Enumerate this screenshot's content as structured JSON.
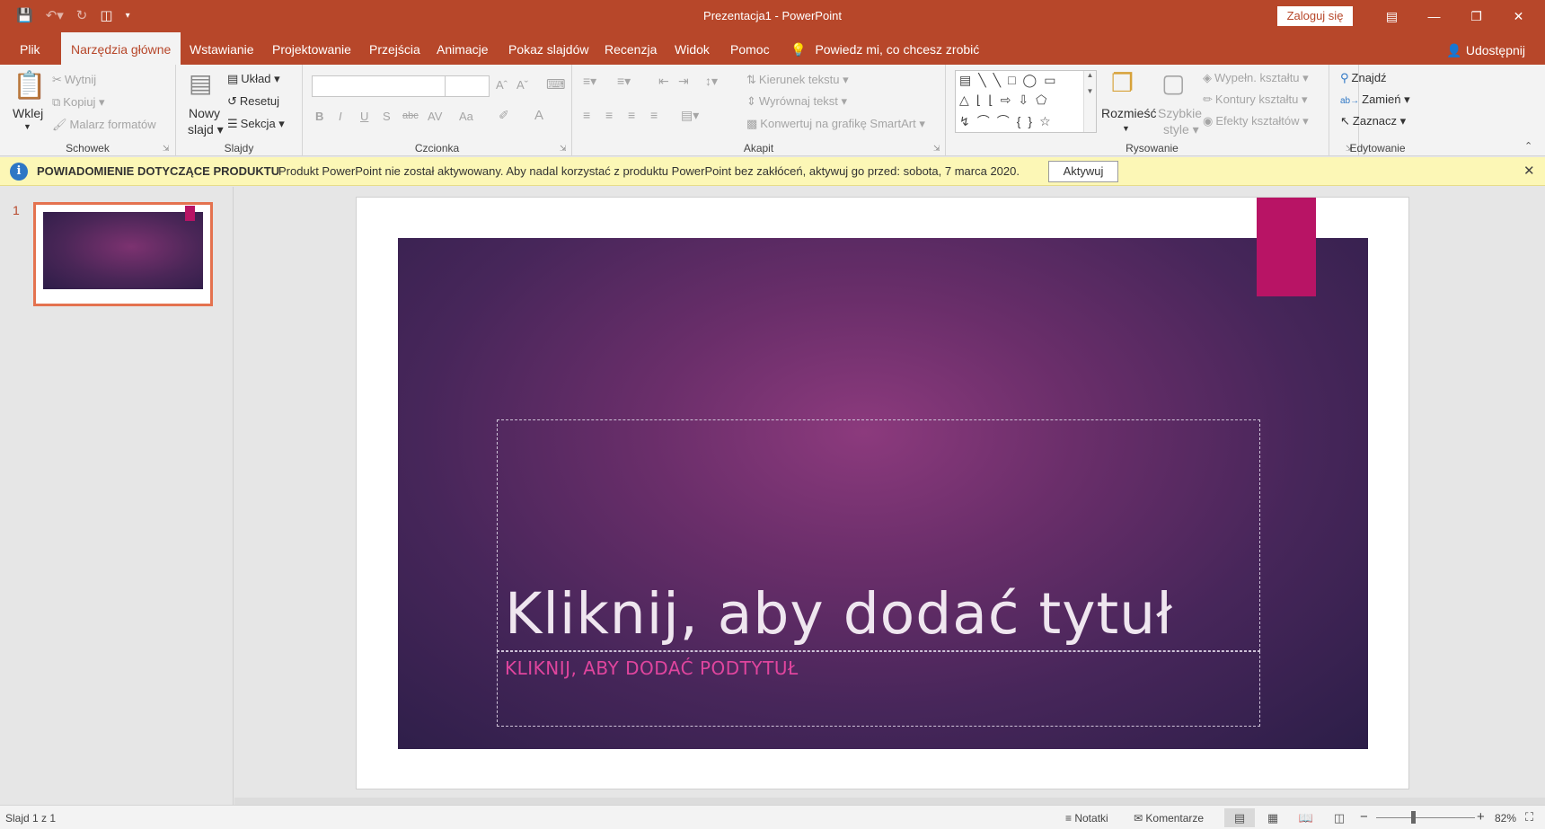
{
  "window": {
    "title": "Prezentacja1  -  PowerPoint",
    "login_label": "Zaloguj się"
  },
  "qat": {
    "icons": [
      "save-icon",
      "undo-icon",
      "redo-icon",
      "start-slideshow-icon",
      "customize-qat-icon"
    ]
  },
  "tabs": [
    {
      "label": "Plik"
    },
    {
      "label": "Narzędzia główne",
      "active": true
    },
    {
      "label": "Wstawianie"
    },
    {
      "label": "Projektowanie"
    },
    {
      "label": "Przejścia"
    },
    {
      "label": "Animacje"
    },
    {
      "label": "Pokaz slajdów"
    },
    {
      "label": "Recenzja"
    },
    {
      "label": "Widok"
    },
    {
      "label": "Pomoc"
    }
  ],
  "tell_me": "Powiedz mi, co chcesz zrobić",
  "share_label": "Udostępnij",
  "ribbon": {
    "clipboard": {
      "group": "Schowek",
      "paste": "Wklej",
      "cut": "Wytnij",
      "copy": "Kopiuj",
      "format_painter": "Malarz formatów"
    },
    "slides": {
      "group": "Slajdy",
      "new_slide_1": "Nowy",
      "new_slide_2": "slajd",
      "layout": "Układ",
      "reset": "Resetuj",
      "section": "Sekcja"
    },
    "font": {
      "group": "Czcionka",
      "buttons": [
        "B",
        "I",
        "U",
        "S",
        "abc",
        "AV",
        "Aa",
        "A"
      ]
    },
    "paragraph": {
      "group": "Akapit",
      "text_direction": "Kierunek tekstu",
      "align_text": "Wyrównaj tekst",
      "smartart": "Konwertuj na grafikę SmartArt"
    },
    "drawing": {
      "group": "Rysowanie",
      "arrange": "Rozmieść",
      "quick_styles_1": "Szybkie",
      "quick_styles_2": "style",
      "fill": "Wypełn. kształtu",
      "outline": "Kontury kształtu",
      "effects": "Efekty kształtów"
    },
    "editing": {
      "group": "Edytowanie",
      "find": "Znajdź",
      "replace": "Zamień",
      "select": "Zaznacz"
    }
  },
  "notification": {
    "title": "POWIADOMIENIE DOTYCZĄCE PRODUKTU",
    "message": "Produkt PowerPoint nie został aktywowany. Aby nadal korzystać z produktu PowerPoint bez zakłóceń, aktywuj go przed: sobota, 7 marca 2020.",
    "button": "Aktywuj"
  },
  "thumbnails": [
    {
      "number": "1"
    }
  ],
  "slide": {
    "title_placeholder": "Kliknij, aby dodać tytuł",
    "subtitle_placeholder": "KLIKNIJ, ABY DODAĆ PODTYTUŁ"
  },
  "colors": {
    "accent": "#b7472a",
    "slide_tab": "#b81465",
    "subtitle": "#e0459e"
  },
  "status": {
    "slide_info": "Slajd 1 z 1",
    "notes": "Notatki",
    "comments": "Komentarze",
    "zoom": "82%"
  }
}
